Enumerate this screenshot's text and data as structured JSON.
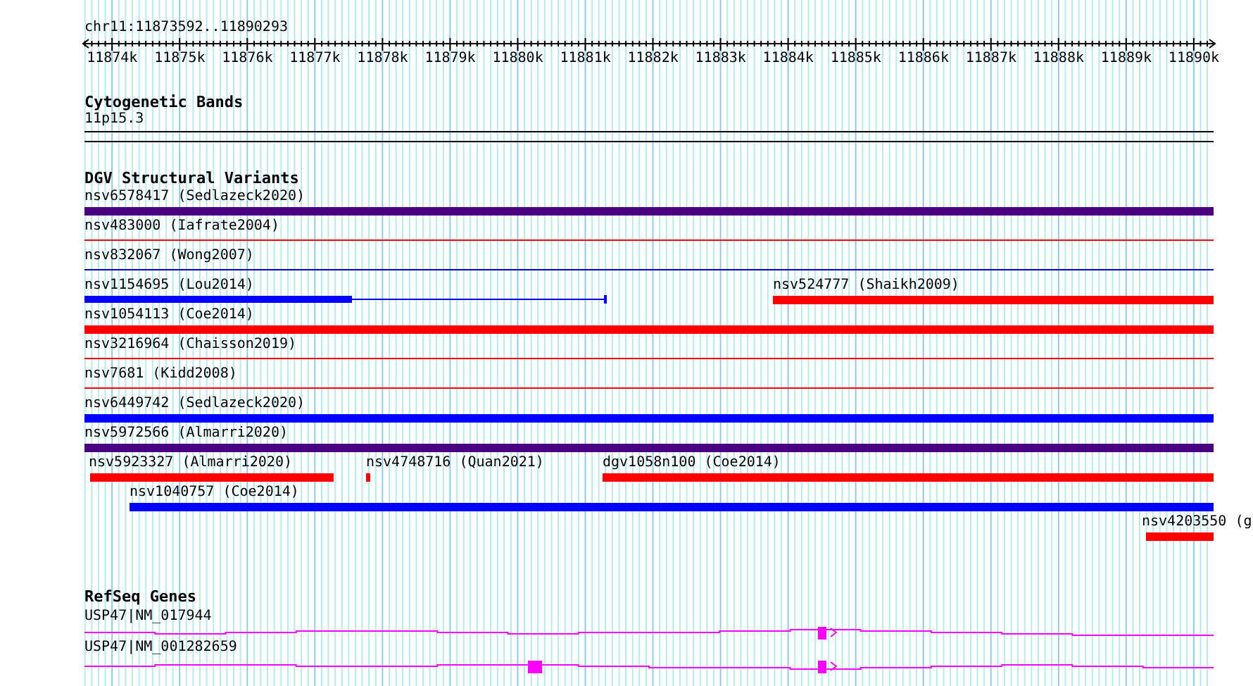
{
  "ruler": {
    "location": "chr11:11873592..11890293",
    "ticks": [
      "11874k",
      "11875k",
      "11876k",
      "11877k",
      "11878k",
      "11879k",
      "11880k",
      "11881k",
      "11882k",
      "11883k",
      "11884k",
      "11885k",
      "11886k",
      "11887k",
      "11888k",
      "11889k",
      "11890k"
    ]
  },
  "cytoband_track": {
    "title": "Cytogenetic Bands",
    "band": "11p15.3"
  },
  "variants_track": {
    "title": "DGV Structural Variants",
    "features": [
      {
        "label": "nsv6578417 (Sedlazeck2020)",
        "color": "#4b0082",
        "kind": "thick"
      },
      {
        "label": "nsv483000 (Iafrate2004)",
        "color": "#ff0000",
        "kind": "thin"
      },
      {
        "label": "nsv832067 (Wong2007)",
        "color": "#0000cc",
        "kind": "thin"
      },
      {
        "label": "nsv1154695 (Lou2014)",
        "color": "#0000ff",
        "kind": "split"
      },
      {
        "label": "nsv524777 (Shaikh2009)",
        "color": "#ff0000",
        "kind": "thick"
      },
      {
        "label": "nsv1054113 (Coe2014)",
        "color": "#ff0000",
        "kind": "thick"
      },
      {
        "label": "nsv3216964 (Chaisson2019)",
        "color": "#ff0000",
        "kind": "thin"
      },
      {
        "label": "nsv7681 (Kidd2008)",
        "color": "#ff0000",
        "kind": "thin"
      },
      {
        "label": "nsv6449742 (Sedlazeck2020)",
        "color": "#0000ff",
        "kind": "thick"
      },
      {
        "label": "nsv5972566 (Almarri2020)",
        "color": "#4b0082",
        "kind": "thick"
      },
      {
        "label": "nsv5923327 (Almarri2020)",
        "color": "#ff0000",
        "kind": "thick"
      },
      {
        "label": "nsv4748716 (Quan2021)",
        "color": "#ff0000",
        "kind": "thick"
      },
      {
        "label": "dgv1058n100 (Coe2014)",
        "color": "#ff0000",
        "kind": "thick"
      },
      {
        "label": "nsv1040757 (Coe2014)",
        "color": "#0000ff",
        "kind": "thick"
      },
      {
        "label": "nsv4203550 (g",
        "color": "#ff0000",
        "kind": "thick"
      }
    ]
  },
  "genes_track": {
    "title": "RefSeq Genes",
    "transcripts": [
      {
        "label": "USP47|NM_017944"
      },
      {
        "label": "USP47|NM_001282659"
      }
    ]
  }
}
